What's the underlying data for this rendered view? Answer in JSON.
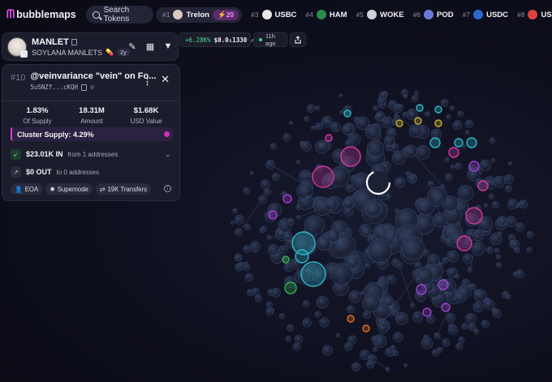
{
  "brand": {
    "name": "bubblemaps",
    "logo_glyph": "ᗰ",
    "accent": "#e24ee6"
  },
  "search": {
    "label": "Search Tokens"
  },
  "trending": [
    {
      "rank": "#1",
      "name": "Trelon",
      "badge": "⚡20",
      "icon_color": "#d8c8c0"
    },
    {
      "rank": "#3",
      "name": "USBC",
      "icon_color": "#e8e8e8"
    },
    {
      "rank": "#4",
      "name": "HAM",
      "icon_color": "#2a8a4a"
    },
    {
      "rank": "#5",
      "name": "WOKE",
      "icon_color": "#d0d0d8"
    },
    {
      "rank": "#6",
      "name": "POD",
      "icon_color": "#6a7ad8"
    },
    {
      "rank": "#7",
      "name": "USDC",
      "icon_color": "#2a6ad0"
    },
    {
      "rank": "#8",
      "name": "USSD",
      "icon_color": "#e04040"
    }
  ],
  "token": {
    "name": "MANLET",
    "subtitle": "SOYLANA MANLETS",
    "age": "2y",
    "pill_icon": "pill-icon"
  },
  "price_pill": {
    "change": "+6.28K%",
    "price": "$0.0₅1330"
  },
  "time_pill": {
    "label": "11h ago"
  },
  "detail": {
    "rank": "#10",
    "title": "@veinvariance \"vein\" on Fo...",
    "address": "5uSNZf...cKQH",
    "stats": [
      {
        "value": "1.83%",
        "label": "Of Supply"
      },
      {
        "value": "18.31M",
        "label": "Amount"
      },
      {
        "value": "$1.68K",
        "label": "USD Value"
      }
    ],
    "cluster": {
      "label": "Cluster Supply: 4.29%",
      "color": "#d130c0"
    },
    "inflow": {
      "value": "$23.01K IN",
      "sub": "from 1 addresses"
    },
    "outflow": {
      "value": "$0 OUT",
      "sub": "to 0 addresses"
    },
    "tags": [
      "EOA",
      "Supernode",
      "19K Transfers"
    ]
  }
}
